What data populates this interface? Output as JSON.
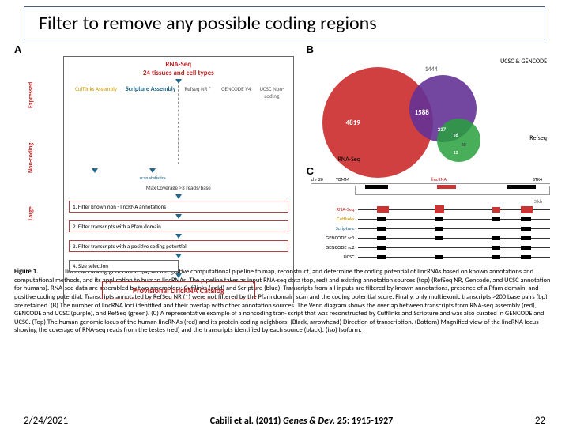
{
  "title": "Filter to remove any possible coding regions",
  "panelA": {
    "label": "A",
    "rnaSeq": "RNA-Seq",
    "subtitle": "24 tissues and cell types",
    "sideLabels": {
      "expressed": "Expressed",
      "noncoding": "Non-coding",
      "large": "Large"
    },
    "assemblers": {
      "cufflinks": "Cufflinks Assembly",
      "scripture": "Scripture Assembly"
    },
    "refs": {
      "refseq": "Refseq NR *",
      "gencode": "GENCODE V4",
      "ucsc": "UCSC Non-coding"
    },
    "scanStats": "scan statistics",
    "maxCov": "Max Coverage >3 reads/base",
    "steps": {
      "s1": "1. Filter known non - lincRNA annotations",
      "s2": "2. Filter transcripts with a Pfam domain",
      "s3": "3. Filter transcripts with a positive coding potential",
      "s4": "4. Size selection"
    },
    "provisional": "Provisional LincRNA Catalog"
  },
  "panelB": {
    "label": "B",
    "ucscGencode": "UCSC & GENCODE",
    "refseq": "Refseq",
    "rnaSeq": "RNA-Seq",
    "counts": {
      "big": "4819",
      "topPurple": "1444",
      "center": "1588",
      "tri": "237",
      "g1": "56",
      "g2": "30",
      "g3": "12"
    }
  },
  "panelC": {
    "label": "C",
    "chr": "chr 20",
    "gene1": "TOMM",
    "linc": "lincRNA",
    "geneR": "STK4",
    "scale": "3 kb",
    "tracks": {
      "rnaSeq": "RNA-Seq",
      "cufflinks": "Cufflinks",
      "scripture": "Scripture",
      "g1": "GENCODE sc1",
      "g2": "GENCODE sc2",
      "ucsc": "UCSC"
    }
  },
  "caption": {
    "lead": "Figure 1.",
    "body": "lincRNA catalog generation. (A) An integrative computational pipeline to map, reconstruct, and determine the coding potential of lincRNAs based on known annotations and computational methods, and its application to human lincRNAs. The pipeline takes as input RNA-seq data (top, red) and existing annotation sources (top) (RefSeq NR, Gencode, and UCSC annotation for humans). RNA-seq data are assembled by two assemblers: Cufflinks (gold) and Scripture (blue). Transcripts from all inputs are filtered by known annotations, presence of a Pfam domain, and positive coding potential. Transcripts annotated by RefSeq NR (*) were not filtered by the Pfam domain scan and the coding potential score. Finally, only multiexonic transcripts >200 base pairs (bp) are retained. (B) The number of lincRNA loci identified and their overlap with other annotation sources. The Venn diagram shows the overlap between transcripts from RNA-seq assembly (red), GENCODE and UCSC (purple), and RefSeq (green). (C) A representative example of a noncoding tran- script that was reconstructed by Cufflinks and Scripture and was also curated in GENCODE and UCSC. (Top) The human genomic locus of the human lincRNAs (red) and its protein-coding neighbors. (Black, arrowhead) Direction of transcription. (Bottom) Magnified view of the lincRNA locus showing the coverage of RNA-seq reads from the testes (red) and the transcripts identified by each source (black). (iso) Isoform."
  },
  "footer": {
    "date": "2/24/2021",
    "citation_prefix": "Cabili et al. (2011) ",
    "citation_journal": "Genes & Dev.",
    "citation_suffix": " 25: 1915-1927",
    "page": "22"
  }
}
